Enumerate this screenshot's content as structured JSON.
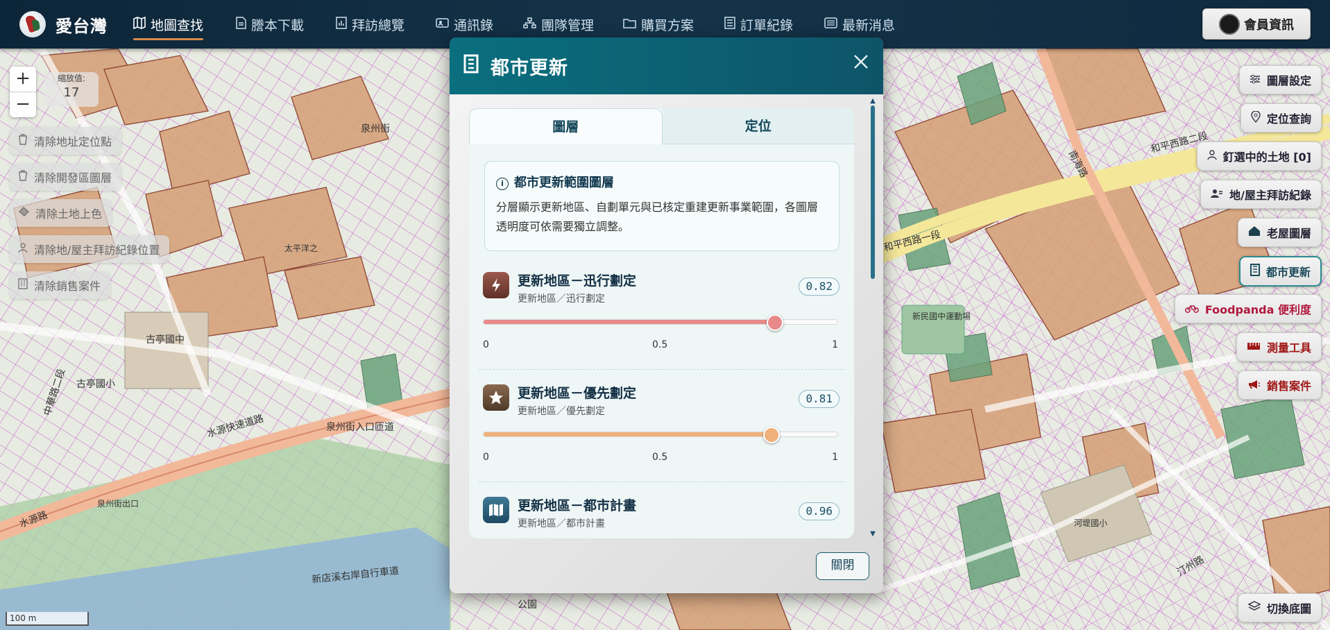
{
  "brand": {
    "name": "愛台灣"
  },
  "nav": [
    {
      "label": "地圖查找",
      "icon": "map-icon",
      "active": true
    },
    {
      "label": "謄本下載",
      "icon": "document-icon",
      "active": false
    },
    {
      "label": "拜訪總覽",
      "icon": "chart-icon",
      "active": false
    },
    {
      "label": "通訊錄",
      "icon": "contact-card-icon",
      "active": false
    },
    {
      "label": "團隊管理",
      "icon": "team-icon",
      "active": false
    },
    {
      "label": "購買方案",
      "icon": "folder-icon",
      "active": false
    },
    {
      "label": "訂單紀錄",
      "icon": "receipt-icon",
      "active": false
    },
    {
      "label": "最新消息",
      "icon": "news-icon",
      "active": false
    }
  ],
  "member": {
    "label": "會員資訊"
  },
  "zoom": {
    "plus": "+",
    "minus": "−",
    "level_label": "縮放值:",
    "level_value": "17"
  },
  "left_actions": [
    {
      "label": "清除地址定位點",
      "icon": "trash-icon"
    },
    {
      "label": "清除開發區圖層",
      "icon": "trash-icon"
    },
    {
      "label": "清除土地上色",
      "icon": "eraser-icon"
    },
    {
      "label": "清除地/屋主拜訪紀錄位置",
      "icon": "person-icon"
    },
    {
      "label": "清除銷售案件",
      "icon": "building-icon"
    }
  ],
  "right_actions": [
    {
      "label": "圖層設定",
      "icon": "sliders-icon"
    },
    {
      "label": "定位查詢",
      "icon": "location-pin-icon"
    },
    {
      "label": "釘選中的土地 [0]",
      "icon": "pin-icon"
    },
    {
      "label": "地/屋主拜訪紀錄",
      "icon": "user-icon"
    },
    {
      "label": "老屋圖層",
      "icon": "house-icon"
    },
    {
      "label": "都市更新",
      "icon": "building-icon"
    },
    {
      "label": "Foodpanda 便利度",
      "icon": "bike-icon"
    },
    {
      "label": "測量工具",
      "icon": "ruler-icon"
    },
    {
      "label": "銷售案件",
      "icon": "megaphone-icon"
    }
  ],
  "basemap": {
    "label": "切換底圖"
  },
  "scale": {
    "label": "100 m"
  },
  "modal": {
    "title": "都市更新",
    "tabs": [
      "圖層",
      "定位"
    ],
    "info": {
      "title": "都市更新範圍圖層",
      "desc": "分層顯示更新地區、自劃單元與已核定重建更新事業範圍，各圖層透明度可依需要獨立調整。"
    },
    "layers": [
      {
        "name": "更新地區－迅行劃定",
        "sub": "更新地區／迅行劃定",
        "value_text": "0.82",
        "value": 0.82,
        "color": "#e88a8a",
        "icon_bg": "#8a4a3e",
        "icon": "lightning-icon"
      },
      {
        "name": "更新地區－優先劃定",
        "sub": "更新地區／優先劃定",
        "value_text": "0.81",
        "value": 0.81,
        "color": "#f0b07a",
        "icon_bg": "#7a5a40",
        "icon": "star-icon"
      },
      {
        "name": "更新地區－都市計畫",
        "sub": "更新地區／都市計畫",
        "value_text": "0.96",
        "value": 0.96,
        "color": "#7aa8c0",
        "icon_bg": "#2e5f7a",
        "icon": "map-fold-icon"
      }
    ],
    "ticks": [
      "0",
      "0.5",
      "1"
    ],
    "close_label": "關閉"
  },
  "map_labels": {
    "roads": [
      "和平西路一段",
      "水源快速道路",
      "水源路",
      "泉州街",
      "南海路",
      "中華路二段",
      "汀州路",
      "泉州街入口匝道",
      "新店溪右岸自行車道",
      "和平西路二段"
    ],
    "places": [
      "古亭國中",
      "古亭國小",
      "新民國中運動場",
      "公園",
      "太平洋之",
      "泉州街出口",
      "河堤國小"
    ]
  }
}
